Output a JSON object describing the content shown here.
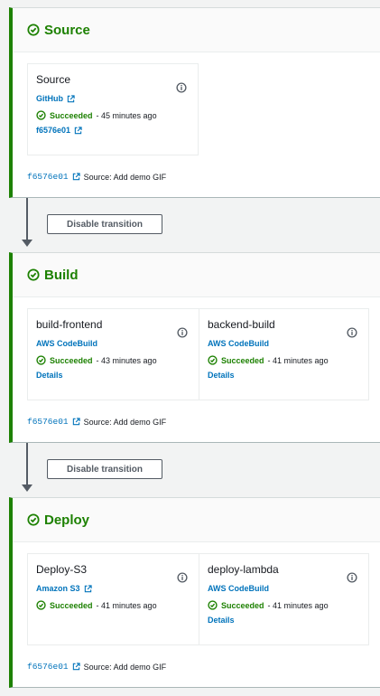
{
  "stages": [
    {
      "title": "Source",
      "actions": [
        {
          "name": "Source",
          "provider": "GitHub",
          "provider_external": true,
          "status": "Succeeded",
          "time": "45 minutes ago",
          "details": "f6576e01",
          "details_external": true
        }
      ],
      "footer": {
        "commit": "f6576e01",
        "message": "Source: Add demo GIF"
      }
    },
    {
      "title": "Build",
      "actions": [
        {
          "name": "build-frontend",
          "provider": "AWS CodeBuild",
          "provider_external": false,
          "status": "Succeeded",
          "time": "43 minutes ago",
          "details": "Details",
          "details_external": false
        },
        {
          "name": "backend-build",
          "provider": "AWS CodeBuild",
          "provider_external": false,
          "status": "Succeeded",
          "time": "41 minutes ago",
          "details": "Details",
          "details_external": false
        }
      ],
      "footer": {
        "commit": "f6576e01",
        "message": "Source: Add demo GIF"
      }
    },
    {
      "title": "Deploy",
      "actions": [
        {
          "name": "Deploy-S3",
          "provider": "Amazon S3",
          "provider_external": true,
          "status": "Succeeded",
          "time": "41 minutes ago",
          "details": "",
          "details_external": false
        },
        {
          "name": "deploy-lambda",
          "provider": "AWS CodeBuild",
          "provider_external": false,
          "status": "Succeeded",
          "time": "41 minutes ago",
          "details": "Details",
          "details_external": false
        }
      ],
      "footer": {
        "commit": "f6576e01",
        "message": "Source: Add demo GIF"
      }
    }
  ],
  "transitions": [
    {
      "label": "Disable transition"
    },
    {
      "label": "Disable transition"
    }
  ],
  "colors": {
    "success": "#1d8102",
    "link": "#0073bb",
    "arrow": "#545b64"
  }
}
